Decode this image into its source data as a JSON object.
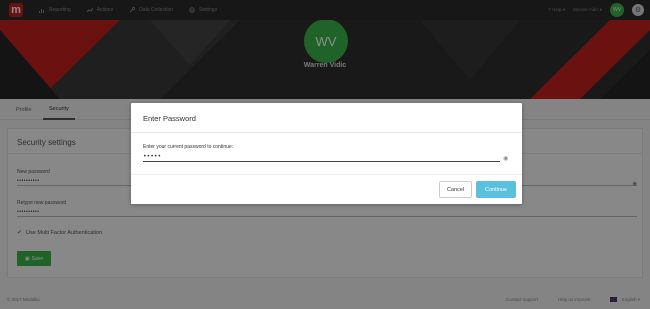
{
  "nav": {
    "logo": "m",
    "items": [
      {
        "label": "Reporting",
        "icon": "chart-icon"
      },
      {
        "label": "Actions",
        "icon": "actions-icon"
      },
      {
        "label": "Data Collection",
        "icon": "wrench-icon"
      },
      {
        "label": "Settings",
        "icon": "gear-icon"
      }
    ],
    "help": "Help",
    "user_name": "Warren Vidic",
    "user_initials": "WV"
  },
  "profile": {
    "initials": "WV",
    "name": "Warren Vidic"
  },
  "tabs": [
    {
      "label": "Profile",
      "active": false
    },
    {
      "label": "Security",
      "active": true
    }
  ],
  "security": {
    "title": "Security settings",
    "new_password_label": "New password",
    "new_password_value": "••••••••••",
    "retype_label": "Retype new password",
    "retype_value": "••••••••••",
    "mfa_label": "Use Multi Factor Authentication",
    "save_label": "Save"
  },
  "footer": {
    "copyright": "© 2017 Medallia",
    "contact": "Contact support",
    "improve": "Help us improve",
    "language": "English"
  },
  "modal": {
    "title": "Enter Password",
    "label": "Enter your current password to continue:",
    "password_value": "•••••",
    "cancel": "Cancel",
    "continue": "Continue"
  },
  "colors": {
    "brand_red": "#c4211f",
    "brand_green": "#3bb54a",
    "continue_blue": "#5bc0de"
  }
}
